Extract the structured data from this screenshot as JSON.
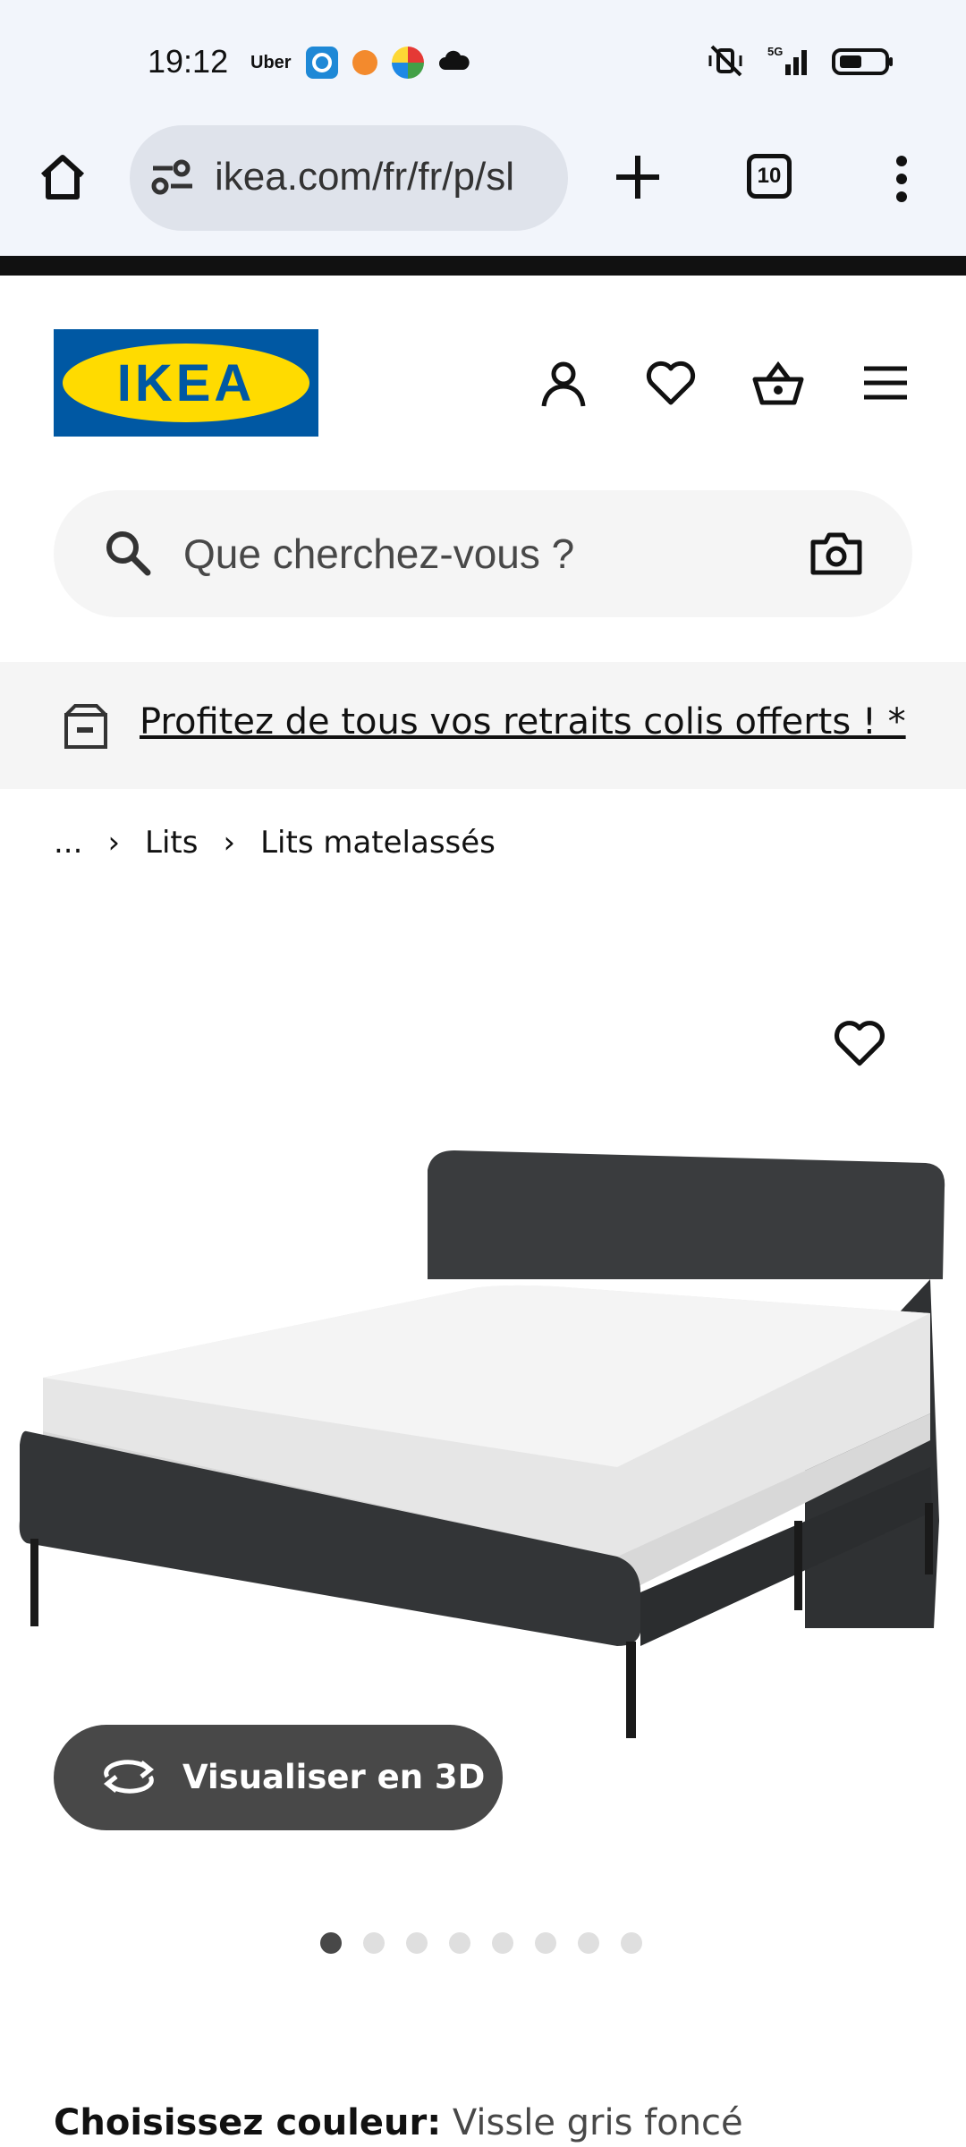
{
  "status_bar": {
    "time": "19:12",
    "apps": [
      "Uber",
      "camera-app-icon",
      "burger-king-icon",
      "colorful-app-icon",
      "cloud-icon"
    ],
    "right_icons": [
      "silent-vibrate-icon",
      "5g-signal-icon",
      "battery-icon"
    ],
    "network": "5G"
  },
  "browser": {
    "url": "ikea.com/fr/fr/p/sl",
    "tab_count": "10"
  },
  "header": {
    "logo_text": "IKEA",
    "logo_colors": {
      "blue": "#0058a3",
      "yellow": "#ffdb00"
    }
  },
  "search": {
    "placeholder": "Que cherchez-vous ?"
  },
  "promo": {
    "text": "Profitez de tous vos retraits colis offerts ! *"
  },
  "breadcrumb": {
    "items": [
      "...",
      "Lits",
      "Lits matelassés"
    ]
  },
  "product": {
    "view_3d_label": "Visualiser en 3D",
    "image_count": 8,
    "active_image_index": 1,
    "color_label": "Choisissez couleur:",
    "color_value": "Vissle gris foncé"
  }
}
